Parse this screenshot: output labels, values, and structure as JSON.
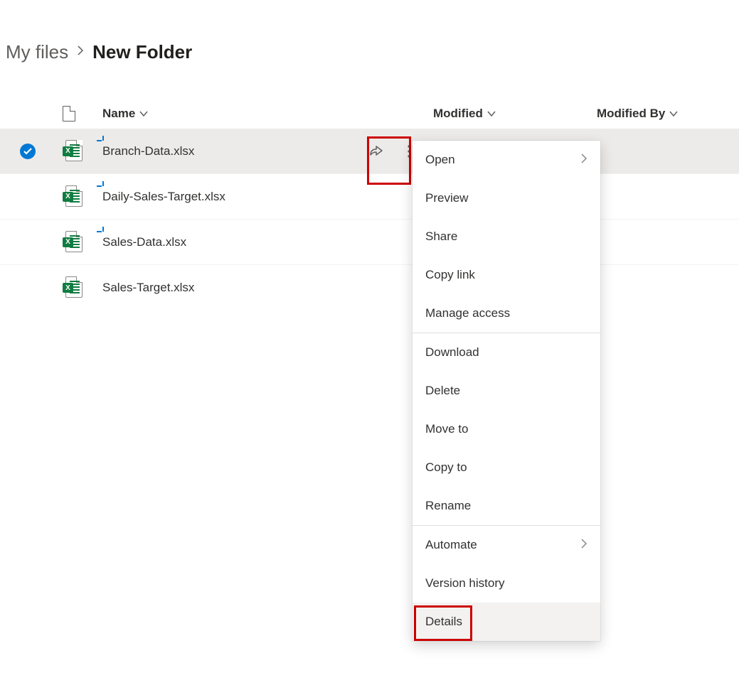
{
  "breadcrumb": {
    "parent": "My files",
    "current": "New Folder"
  },
  "columns": {
    "name": "Name",
    "modified": "Modified",
    "modifiedBy": "Modified By"
  },
  "files": [
    {
      "name": "Branch-Data.xlsx",
      "selected": true,
      "isNew": true
    },
    {
      "name": "Daily-Sales-Target.xlsx",
      "selected": false,
      "isNew": true
    },
    {
      "name": "Sales-Data.xlsx",
      "selected": false,
      "isNew": true
    },
    {
      "name": "Sales-Target.xlsx",
      "selected": false,
      "isNew": false
    }
  ],
  "menu": {
    "open": "Open",
    "preview": "Preview",
    "share": "Share",
    "copyLink": "Copy link",
    "manageAccess": "Manage access",
    "download": "Download",
    "delete": "Delete",
    "moveTo": "Move to",
    "copyTo": "Copy to",
    "rename": "Rename",
    "automate": "Automate",
    "versionHistory": "Version history",
    "details": "Details"
  }
}
